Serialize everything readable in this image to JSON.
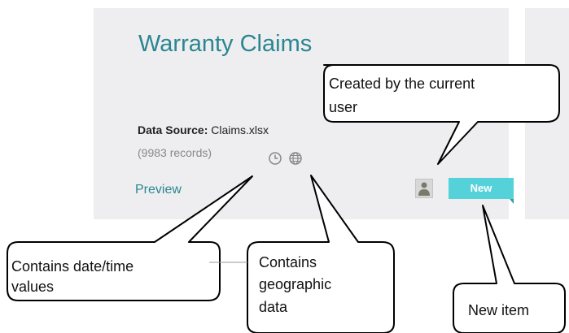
{
  "card": {
    "title": "Warranty Claims",
    "data_source_label": "Data Source:",
    "data_source_value": "Claims.xlsx",
    "records": "(9983 records)",
    "feature_icons": [
      "clock-icon",
      "globe-icon"
    ],
    "preview_link": "Preview",
    "owner_icon": "user-icon",
    "new_badge": "New"
  },
  "callouts": {
    "created_by_line1": "Created by the current",
    "created_by_line2": "user",
    "date_time_line1": "Contains date/time",
    "date_time_line2": "values",
    "geo_line1": "Contains",
    "geo_line2": "geographic",
    "geo_line3": "data",
    "new_item": "New item"
  },
  "colors": {
    "card_background": "#eeeef0",
    "title": "#2a8690",
    "new_badge": "#55d1d9"
  }
}
